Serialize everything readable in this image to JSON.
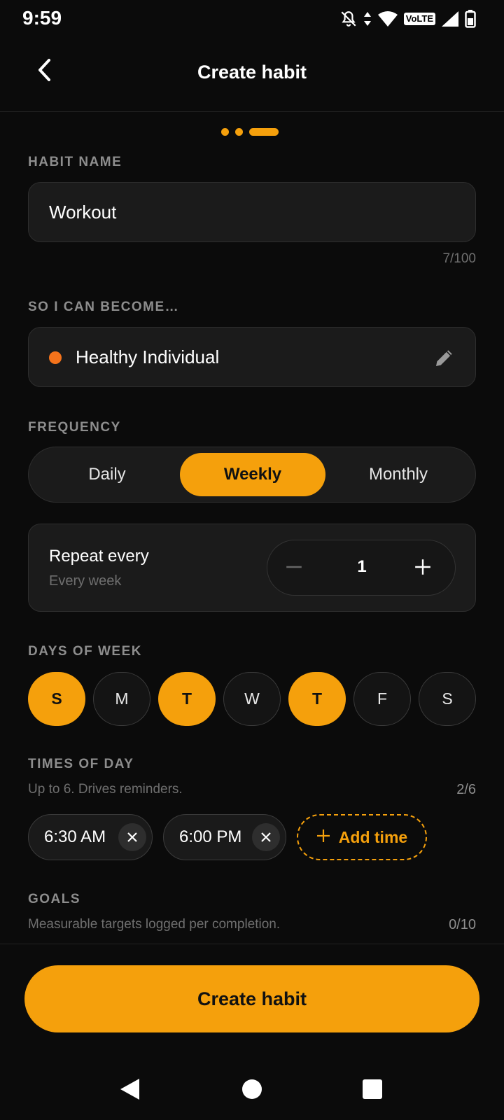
{
  "status_bar": {
    "time": "9:59",
    "network_label": "VoLTE"
  },
  "header": {
    "title": "Create habit"
  },
  "habit_name": {
    "label": "HABIT NAME",
    "value": "Workout",
    "counter": "7/100"
  },
  "identity": {
    "label": "SO I CAN BECOME…",
    "value": "Healthy Individual",
    "dot_color": "#f5731b"
  },
  "frequency": {
    "label": "FREQUENCY",
    "options": [
      "Daily",
      "Weekly",
      "Monthly"
    ],
    "selected": "Weekly"
  },
  "repeat": {
    "title": "Repeat every",
    "subtitle": "Every week",
    "value": "1"
  },
  "days": {
    "label": "DAYS OF WEEK",
    "items": [
      {
        "letter": "S",
        "selected": true
      },
      {
        "letter": "M",
        "selected": false
      },
      {
        "letter": "T",
        "selected": true
      },
      {
        "letter": "W",
        "selected": false
      },
      {
        "letter": "T",
        "selected": true
      },
      {
        "letter": "F",
        "selected": false
      },
      {
        "letter": "S",
        "selected": false
      }
    ]
  },
  "times": {
    "label": "TIMES OF DAY",
    "hint": "Up to 6. Drives reminders.",
    "counter": "2/6",
    "items": [
      "6:30 AM",
      "6:00 PM"
    ],
    "add_label": "Add time"
  },
  "goals": {
    "label": "GOALS",
    "hint": "Measurable targets logged per completion.",
    "counter": "0/10"
  },
  "footer": {
    "create_label": "Create habit"
  },
  "colors": {
    "accent": "#f5a00c",
    "background": "#0b0b0b",
    "card": "#1b1b1b"
  }
}
